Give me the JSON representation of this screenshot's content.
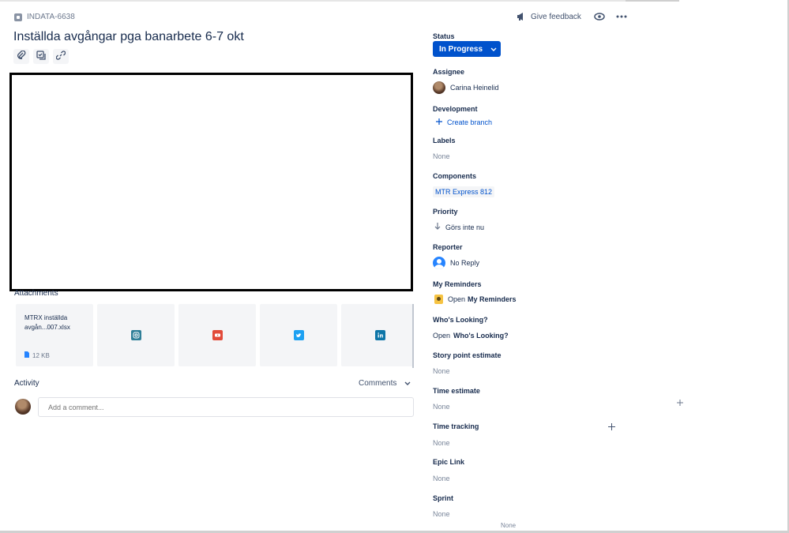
{
  "issue": {
    "key": "INDATA-6638",
    "title": "Inställda avgångar pga banarbete 6-7 okt"
  },
  "header": {
    "feedback_label": "Give feedback"
  },
  "attachments": {
    "label": "Attachments",
    "items": [
      {
        "name": "MTRX inställda avgån...007.xlsx",
        "size": "12 KB"
      },
      {
        "icon": "instagram-icon",
        "color": "#2f7f98"
      },
      {
        "icon": "youtube-icon",
        "color": "#e24b3a"
      },
      {
        "icon": "twitter-icon",
        "color": "#1da1f2"
      },
      {
        "icon": "linkedin-icon",
        "color": "#0e76a8"
      }
    ]
  },
  "activity": {
    "label": "Activity",
    "filter": "Comments",
    "comment_placeholder": "Add a comment..."
  },
  "sidebar": {
    "status_label": "Status",
    "status_value": "In Progress",
    "assignee_label": "Assignee",
    "assignee_value": "Carina Heinelid",
    "development_label": "Development",
    "create_branch": "Create branch",
    "labels_label": "Labels",
    "labels_value": "None",
    "components_label": "Components",
    "components_value": "MTR Express 812",
    "priority_label": "Priority",
    "priority_value": "Görs inte nu",
    "reporter_label": "Reporter",
    "reporter_value": "No Reply",
    "reminders_label": "My Reminders",
    "reminders_open": "Open",
    "reminders_link": "My Reminders",
    "whos_looking_label": "Who's Looking?",
    "whos_looking_open": "Open",
    "whos_looking_link": "Who's Looking?",
    "story_points_label": "Story point estimate",
    "story_points_value": "None",
    "time_estimate_label": "Time estimate",
    "time_estimate_value": "None",
    "time_tracking_label": "Time tracking",
    "time_tracking_value": "None",
    "epic_link_label": "Epic Link",
    "epic_link_value": "None",
    "sprint_label": "Sprint",
    "sprint_value": "None",
    "bottom_value": "None"
  },
  "colors": {
    "primary": "#0052cc",
    "text": "#172b4d",
    "muted": "#7a869a"
  }
}
